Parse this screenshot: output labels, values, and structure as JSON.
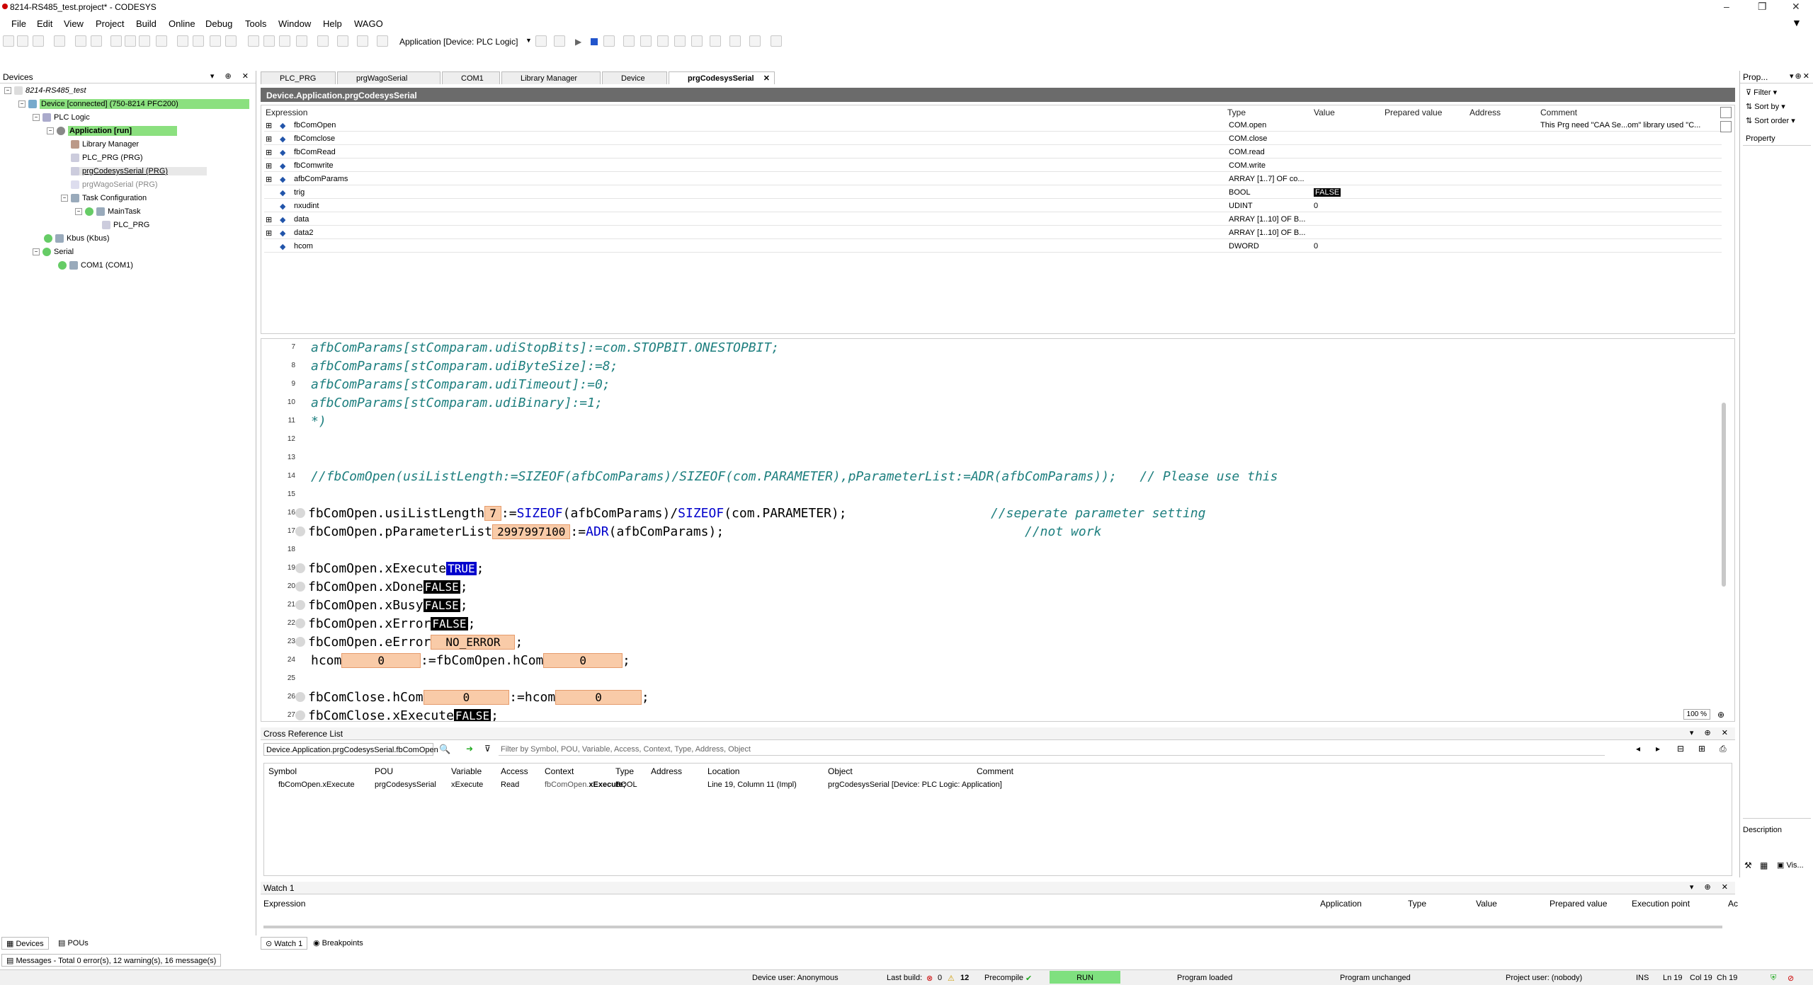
{
  "window": {
    "title": "8214-RS485_test.project* - CODESYS"
  },
  "menu": [
    "File",
    "Edit",
    "View",
    "Project",
    "Build",
    "Online",
    "Debug",
    "Tools",
    "Window",
    "Help",
    "WAGO"
  ],
  "toolbar": {
    "app_selector": "Application [Device: PLC Logic]"
  },
  "devices_panel": {
    "title": "Devices",
    "tree": [
      {
        "label": "8214-RS485_test",
        "depth": 0
      },
      {
        "label": "Device [connected] (750-8214 PFC200)",
        "depth": 1,
        "highlight": true
      },
      {
        "label": "PLC Logic",
        "depth": 2
      },
      {
        "label": "Application [run]",
        "depth": 3,
        "highlight": true
      },
      {
        "label": "Library Manager",
        "depth": 4
      },
      {
        "label": "PLC_PRG (PRG)",
        "depth": 4
      },
      {
        "label": "prgCodesysSerial (PRG)",
        "depth": 4
      },
      {
        "label": "prgWagoSerial (PRG)",
        "depth": 4
      },
      {
        "label": "Task Configuration",
        "depth": 4
      },
      {
        "label": "MainTask",
        "depth": 5
      },
      {
        "label": "PLC_PRG",
        "depth": 6
      },
      {
        "label": "Kbus (Kbus)",
        "depth": 2
      },
      {
        "label": "Serial",
        "depth": 2
      },
      {
        "label": "COM1 (COM1)",
        "depth": 3
      }
    ]
  },
  "editor_tabs": [
    "PLC_PRG",
    "prgWagoSerial",
    "COM1",
    "Library Manager",
    "Device",
    "prgCodesysSerial"
  ],
  "decl": {
    "header": "Device.Application.prgCodesysSerial",
    "columns": [
      "Expression",
      "Type",
      "Value",
      "Prepared value",
      "Address",
      "Comment"
    ],
    "rows": [
      {
        "expr": "fbComOpen",
        "type": "COM.open",
        "value": "",
        "comment": "This Prg need \"CAA Se...om\" library used \"C..."
      },
      {
        "expr": "fbComclose",
        "type": "COM.close",
        "value": "",
        "comment": ""
      },
      {
        "expr": "fbComRead",
        "type": "COM.read",
        "value": "",
        "comment": ""
      },
      {
        "expr": "fbComwrite",
        "type": "COM.write",
        "value": "",
        "comment": ""
      },
      {
        "expr": "afbComParams",
        "type": "ARRAY [1..7] OF co...",
        "value": "",
        "comment": ""
      },
      {
        "expr": "trig",
        "type": "BOOL",
        "value": "FALSE",
        "comment": ""
      },
      {
        "expr": "nxudint",
        "type": "UDINT",
        "value": "0",
        "comment": ""
      },
      {
        "expr": "data",
        "type": "ARRAY [1..10] OF B...",
        "value": "",
        "comment": ""
      },
      {
        "expr": "data2",
        "type": "ARRAY [1..10] OF B...",
        "value": "",
        "comment": ""
      },
      {
        "expr": "hcom",
        "type": "DWORD",
        "value": "0",
        "comment": ""
      }
    ]
  },
  "code": {
    "zoom": "100 %",
    "line_numbers": [
      "7",
      "8",
      "9",
      "10",
      "11",
      "12",
      "13",
      "14",
      "15",
      "16",
      "17",
      "18",
      "19",
      "20",
      "21",
      "22",
      "23",
      "24",
      "25",
      "26",
      "27"
    ],
    "l1": "afbComParams[stComparam.udiStopBits]:=com.STOPBIT.ONESTOPBIT;",
    "l2": "afbComParams[stComparam.udiByteSize]:=8;",
    "l3": "afbComParams[stComparam.udiTimeout]:=0;",
    "l4": "afbComParams[stComparam.udiBinary]:=1;",
    "l5": "*)",
    "l6": "//fbComOpen(usiListLength:=SIZEOF(afbComParams)/SIZEOF(com.PARAMETER),pParameterList:=ADR(afbComParams));   // Please use this",
    "l7a": "fbComOpen.usiListLength",
    "l7v": "7",
    "l7b": ":=",
    "l7c": "SIZEOF",
    "l7d": "(afbComParams)/",
    "l7e": "SIZEOF",
    "l7f": "(com.PARAMETER);",
    "l7g": "//seperate parameter setting",
    "l8a": "fbComOpen.pParameterList",
    "l8v": "2997997100",
    "l8b": ":=",
    "l8c": "ADR",
    "l8d": "(afbComParams);",
    "l8g": "//not work",
    "l9a": "fbComOpen.xExecute",
    "l9v": "TRUE",
    "l10a": "fbComOpen.xDone",
    "l10v": "FALSE",
    "l11a": "fbComOpen.xBusy",
    "l11v": "FALSE",
    "l12a": "fbComOpen.xError",
    "l12v": "FALSE",
    "l13a": "fbComOpen.eError",
    "l13v": "NO_ERROR",
    "l14a": "hcom",
    "l14v": "0",
    "l14b": ":=fbComOpen.hCom",
    "l14v2": "0",
    "l15a": "fbComClose.hCom",
    "l15v": "0",
    "l15b": ":=hcom",
    "l15v2": "0",
    "l16a": "fbComClose.xExecute",
    "l16v": "FALSE",
    "semi": ";"
  },
  "xref": {
    "title": "Cross Reference List",
    "path": "Device.Application.prgCodesysSerial.fbComOpen",
    "filter_placeholder": "Filter by Symbol, POU, Variable, Access, Context, Type, Address, Object",
    "columns": [
      "Symbol",
      "POU",
      "Variable",
      "Access",
      "Context",
      "Type",
      "Address",
      "Location",
      "Object",
      "Comment"
    ],
    "row": {
      "symbol": "fbComOpen.xExecute",
      "pou": "prgCodesysSerial",
      "variable": "xExecute",
      "access": "Read",
      "context_a": "fbComOpen.",
      "context_b": "xExecute;",
      "type": "BOOL",
      "address": "",
      "location": "Line 19, Column 11 (Impl)",
      "object": "prgCodesysSerial [Device: PLC Logic: Application]",
      "comment": ""
    }
  },
  "watch": {
    "title": "Watch 1",
    "columns": [
      "Expression",
      "Application",
      "Type",
      "Value",
      "Prepared value",
      "Execution point",
      "Ac"
    ]
  },
  "props": {
    "title": "Prop...",
    "filter": "Filter",
    "sort_by": "Sort by",
    "sort_order": "Sort order",
    "property": "Property",
    "description": "Description",
    "vis": "Vis..."
  },
  "bottom_tabs": {
    "devices": "Devices",
    "pous": "POUs",
    "watch1": "Watch 1",
    "breakpoints": "Breakpoints",
    "messages": "Messages - Total 0 error(s), 12 warning(s), 16 message(s)"
  },
  "status": {
    "device_user": "Device user: Anonymous",
    "last_build": "Last build:",
    "errors": "0",
    "warnings": "12",
    "precompile": "Precompile",
    "run": "RUN",
    "program_loaded": "Program loaded",
    "program_unchanged": "Program unchanged",
    "project_user": "Project user: (nobody)",
    "ins": "INS",
    "ln": "Ln 19",
    "col": "Col 19",
    "ch": "Ch 19"
  }
}
